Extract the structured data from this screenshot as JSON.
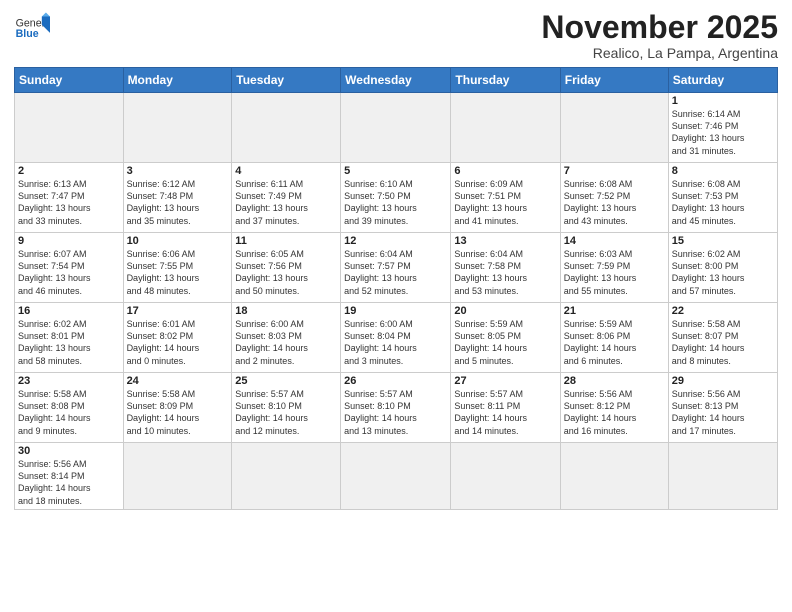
{
  "header": {
    "logo_general": "General",
    "logo_blue": "Blue",
    "month_title": "November 2025",
    "subtitle": "Realico, La Pampa, Argentina"
  },
  "weekdays": [
    "Sunday",
    "Monday",
    "Tuesday",
    "Wednesday",
    "Thursday",
    "Friday",
    "Saturday"
  ],
  "weeks": [
    [
      {
        "day": "",
        "info": ""
      },
      {
        "day": "",
        "info": ""
      },
      {
        "day": "",
        "info": ""
      },
      {
        "day": "",
        "info": ""
      },
      {
        "day": "",
        "info": ""
      },
      {
        "day": "",
        "info": ""
      },
      {
        "day": "1",
        "info": "Sunrise: 6:14 AM\nSunset: 7:46 PM\nDaylight: 13 hours\nand 31 minutes."
      }
    ],
    [
      {
        "day": "2",
        "info": "Sunrise: 6:13 AM\nSunset: 7:47 PM\nDaylight: 13 hours\nand 33 minutes."
      },
      {
        "day": "3",
        "info": "Sunrise: 6:12 AM\nSunset: 7:48 PM\nDaylight: 13 hours\nand 35 minutes."
      },
      {
        "day": "4",
        "info": "Sunrise: 6:11 AM\nSunset: 7:49 PM\nDaylight: 13 hours\nand 37 minutes."
      },
      {
        "day": "5",
        "info": "Sunrise: 6:10 AM\nSunset: 7:50 PM\nDaylight: 13 hours\nand 39 minutes."
      },
      {
        "day": "6",
        "info": "Sunrise: 6:09 AM\nSunset: 7:51 PM\nDaylight: 13 hours\nand 41 minutes."
      },
      {
        "day": "7",
        "info": "Sunrise: 6:08 AM\nSunset: 7:52 PM\nDaylight: 13 hours\nand 43 minutes."
      },
      {
        "day": "8",
        "info": "Sunrise: 6:08 AM\nSunset: 7:53 PM\nDaylight: 13 hours\nand 45 minutes."
      }
    ],
    [
      {
        "day": "9",
        "info": "Sunrise: 6:07 AM\nSunset: 7:54 PM\nDaylight: 13 hours\nand 46 minutes."
      },
      {
        "day": "10",
        "info": "Sunrise: 6:06 AM\nSunset: 7:55 PM\nDaylight: 13 hours\nand 48 minutes."
      },
      {
        "day": "11",
        "info": "Sunrise: 6:05 AM\nSunset: 7:56 PM\nDaylight: 13 hours\nand 50 minutes."
      },
      {
        "day": "12",
        "info": "Sunrise: 6:04 AM\nSunset: 7:57 PM\nDaylight: 13 hours\nand 52 minutes."
      },
      {
        "day": "13",
        "info": "Sunrise: 6:04 AM\nSunset: 7:58 PM\nDaylight: 13 hours\nand 53 minutes."
      },
      {
        "day": "14",
        "info": "Sunrise: 6:03 AM\nSunset: 7:59 PM\nDaylight: 13 hours\nand 55 minutes."
      },
      {
        "day": "15",
        "info": "Sunrise: 6:02 AM\nSunset: 8:00 PM\nDaylight: 13 hours\nand 57 minutes."
      }
    ],
    [
      {
        "day": "16",
        "info": "Sunrise: 6:02 AM\nSunset: 8:01 PM\nDaylight: 13 hours\nand 58 minutes."
      },
      {
        "day": "17",
        "info": "Sunrise: 6:01 AM\nSunset: 8:02 PM\nDaylight: 14 hours\nand 0 minutes."
      },
      {
        "day": "18",
        "info": "Sunrise: 6:00 AM\nSunset: 8:03 PM\nDaylight: 14 hours\nand 2 minutes."
      },
      {
        "day": "19",
        "info": "Sunrise: 6:00 AM\nSunset: 8:04 PM\nDaylight: 14 hours\nand 3 minutes."
      },
      {
        "day": "20",
        "info": "Sunrise: 5:59 AM\nSunset: 8:05 PM\nDaylight: 14 hours\nand 5 minutes."
      },
      {
        "day": "21",
        "info": "Sunrise: 5:59 AM\nSunset: 8:06 PM\nDaylight: 14 hours\nand 6 minutes."
      },
      {
        "day": "22",
        "info": "Sunrise: 5:58 AM\nSunset: 8:07 PM\nDaylight: 14 hours\nand 8 minutes."
      }
    ],
    [
      {
        "day": "23",
        "info": "Sunrise: 5:58 AM\nSunset: 8:08 PM\nDaylight: 14 hours\nand 9 minutes."
      },
      {
        "day": "24",
        "info": "Sunrise: 5:58 AM\nSunset: 8:09 PM\nDaylight: 14 hours\nand 10 minutes."
      },
      {
        "day": "25",
        "info": "Sunrise: 5:57 AM\nSunset: 8:10 PM\nDaylight: 14 hours\nand 12 minutes."
      },
      {
        "day": "26",
        "info": "Sunrise: 5:57 AM\nSunset: 8:10 PM\nDaylight: 14 hours\nand 13 minutes."
      },
      {
        "day": "27",
        "info": "Sunrise: 5:57 AM\nSunset: 8:11 PM\nDaylight: 14 hours\nand 14 minutes."
      },
      {
        "day": "28",
        "info": "Sunrise: 5:56 AM\nSunset: 8:12 PM\nDaylight: 14 hours\nand 16 minutes."
      },
      {
        "day": "29",
        "info": "Sunrise: 5:56 AM\nSunset: 8:13 PM\nDaylight: 14 hours\nand 17 minutes."
      }
    ],
    [
      {
        "day": "30",
        "info": "Sunrise: 5:56 AM\nSunset: 8:14 PM\nDaylight: 14 hours\nand 18 minutes."
      },
      {
        "day": "",
        "info": ""
      },
      {
        "day": "",
        "info": ""
      },
      {
        "day": "",
        "info": ""
      },
      {
        "day": "",
        "info": ""
      },
      {
        "day": "",
        "info": ""
      },
      {
        "day": "",
        "info": ""
      }
    ]
  ]
}
